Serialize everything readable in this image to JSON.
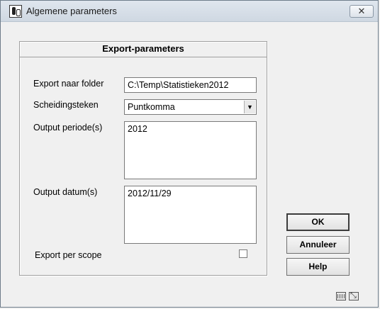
{
  "window": {
    "title": "Algemene parameters",
    "close_label": "✕"
  },
  "group": {
    "title": "Export-parameters"
  },
  "form": {
    "export_folder_label": "Export naar folder",
    "export_folder_value": "C:\\Temp\\Statistieken2012",
    "separator_label": "Scheidingsteken",
    "separator_value": "Puntkomma",
    "output_period_label": "Output periode(s)",
    "output_period_value": "2012",
    "output_date_label": "Output datum(s)",
    "output_date_value": "2012/11/29",
    "export_scope_label": "Export per scope",
    "export_scope_checked": false
  },
  "buttons": {
    "ok": "OK",
    "cancel": "Annuleer",
    "help": "Help"
  },
  "icons": {
    "app": "app-icon",
    "keyboard": "keyboard-icon",
    "expand": "expand-icon",
    "dropdown": "chevron-down-icon"
  }
}
